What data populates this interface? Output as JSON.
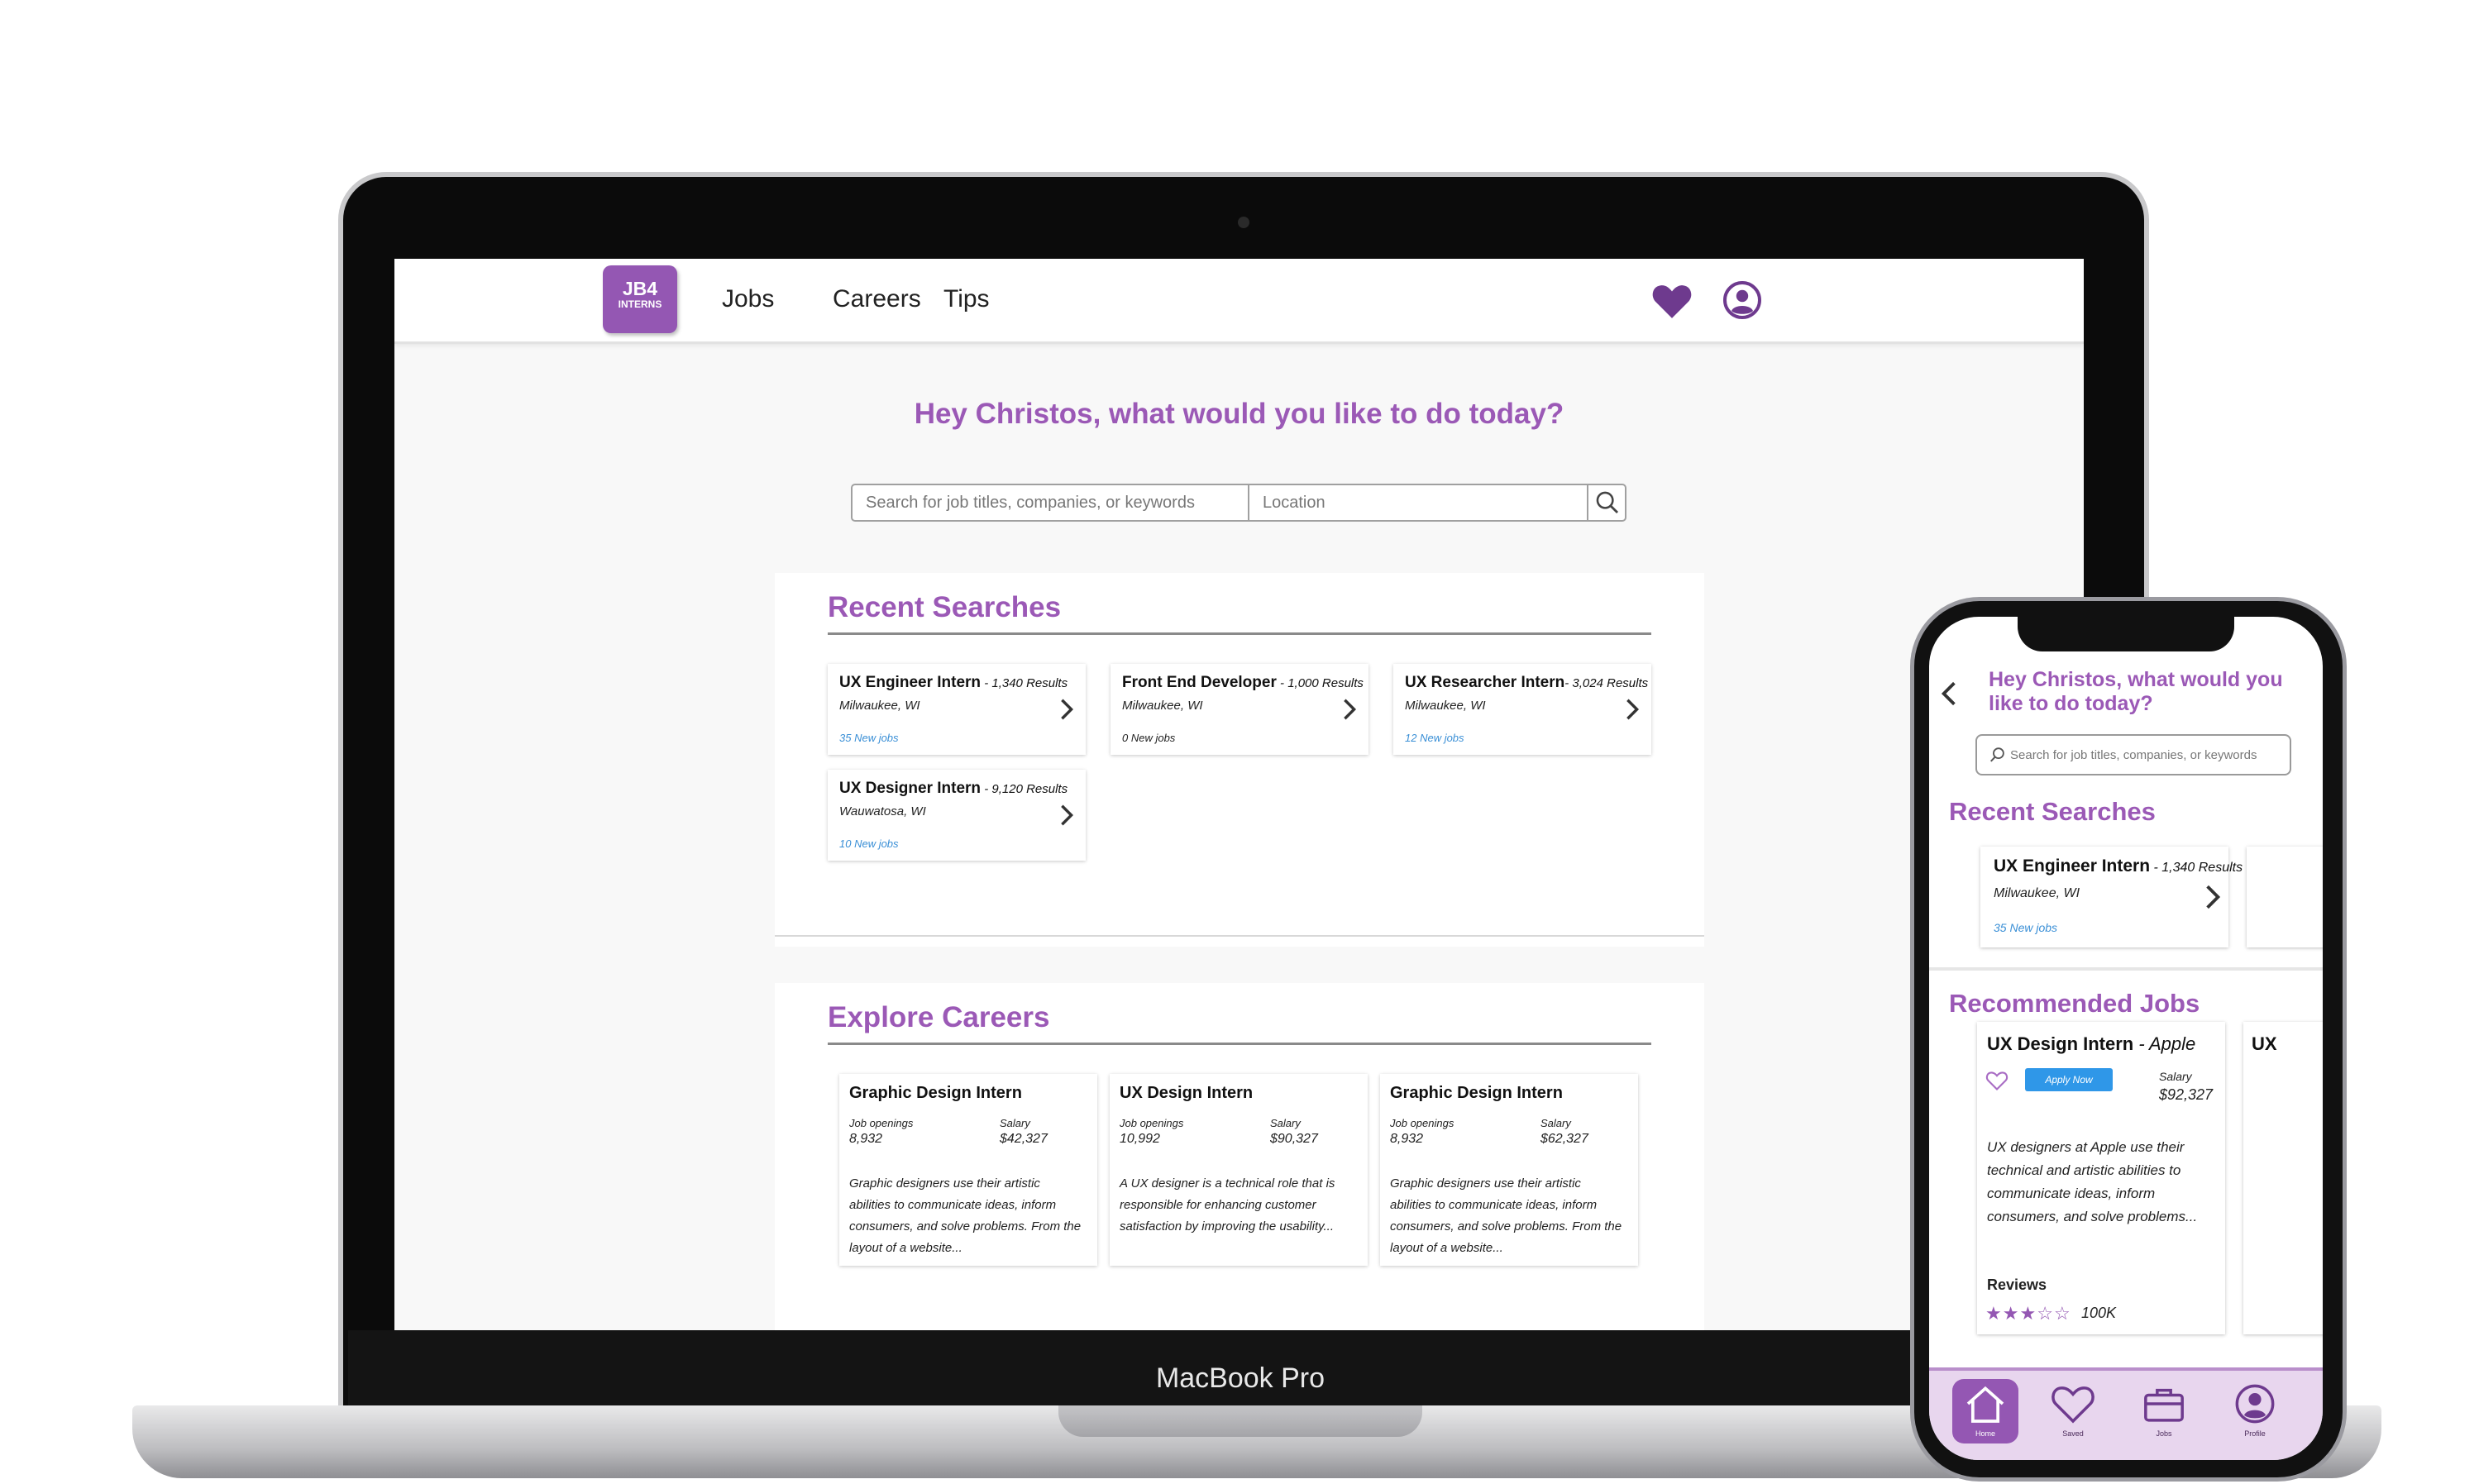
{
  "device_label": "MacBook Pro",
  "colors": {
    "accent": "#9b59b6",
    "logo": "#9457b3",
    "link": "#3a8fd6",
    "apply": "#2f97e8"
  },
  "desktop": {
    "logo": {
      "line1": "JB4",
      "line2": "INTERNS"
    },
    "nav": [
      "Jobs",
      "Careers",
      "Tips"
    ],
    "icons": {
      "favorites": "heart-icon",
      "account": "user-circle-icon"
    },
    "greeting": "Hey Christos, what would you like to do today?",
    "search": {
      "keywords_placeholder": "Search for job titles, companies, or keywords",
      "location_placeholder": "Location"
    },
    "recent_searches": {
      "title": "Recent Searches",
      "items": [
        {
          "title": "UX Engineer Intern",
          "results": " - 1,340 Results",
          "location": "Milwaukee, WI",
          "new_jobs": "35 New jobs"
        },
        {
          "title": "Front End Developer",
          "results": " - 1,000 Results",
          "location": "Milwaukee, WI",
          "new_jobs": "0 New jobs"
        },
        {
          "title": "UX Researcher Intern",
          "results": "- 3,024 Results",
          "location": "Milwaukee, WI",
          "new_jobs": "12 New jobs"
        },
        {
          "title": "UX Designer Intern",
          "results": " - 9,120 Results",
          "location": "Wauwatosa, WI",
          "new_jobs": "10 New jobs"
        }
      ]
    },
    "explore_careers": {
      "title": "Explore Careers",
      "items": [
        {
          "title": "Graphic Design Intern",
          "openings_label": "Job openings",
          "openings": "8,932",
          "salary_label": "Salary",
          "salary": "$42,327",
          "description": "Graphic designers use their artistic abilities to communicate ideas, inform consumers, and solve problems. From the layout of a website..."
        },
        {
          "title": "UX Design Intern",
          "openings_label": "Job openings",
          "openings": "10,992",
          "salary_label": "Salary",
          "salary": "$90,327",
          "description": "A UX designer is a technical role that is responsible for enhancing customer satisfaction by improving the usability..."
        },
        {
          "title": "Graphic Design Intern",
          "openings_label": "Job openings",
          "openings": "8,932",
          "salary_label": "Salary",
          "salary": "$62,327",
          "description": "Graphic designers use their artistic abilities to communicate ideas, inform consumers, and solve problems. From the layout of a website..."
        }
      ]
    }
  },
  "mobile": {
    "greeting": "Hey Christos, what would you like to do today?",
    "search_placeholder": "Search for job titles, companies, or keywords",
    "recent_title": "Recent Searches",
    "recent_item": {
      "title": "UX Engineer Intern",
      "results": " - 1,340 Results",
      "location": "Milwaukee, WI",
      "new_jobs": "35 New jobs"
    },
    "recommended_title": "Recommended Jobs",
    "job": {
      "title": "UX Design Intern",
      "company": " - Apple",
      "apply": "Apply Now",
      "salary_label": "Salary",
      "salary": "$92,327",
      "description": "UX designers at Apple use their technical and artistic abilities to communicate ideas, inform consumers, and solve problems...",
      "reviews_label": "Reviews",
      "rating": 3,
      "rating_max": 5,
      "review_count": "100K"
    },
    "peek_job_title": "UX",
    "tabs": [
      {
        "label": "Home",
        "icon": "home-icon",
        "active": true
      },
      {
        "label": "Saved",
        "icon": "heart-icon",
        "active": false
      },
      {
        "label": "Jobs",
        "icon": "briefcase-icon",
        "active": false
      },
      {
        "label": "Profile",
        "icon": "user-circle-icon",
        "active": false
      }
    ]
  }
}
